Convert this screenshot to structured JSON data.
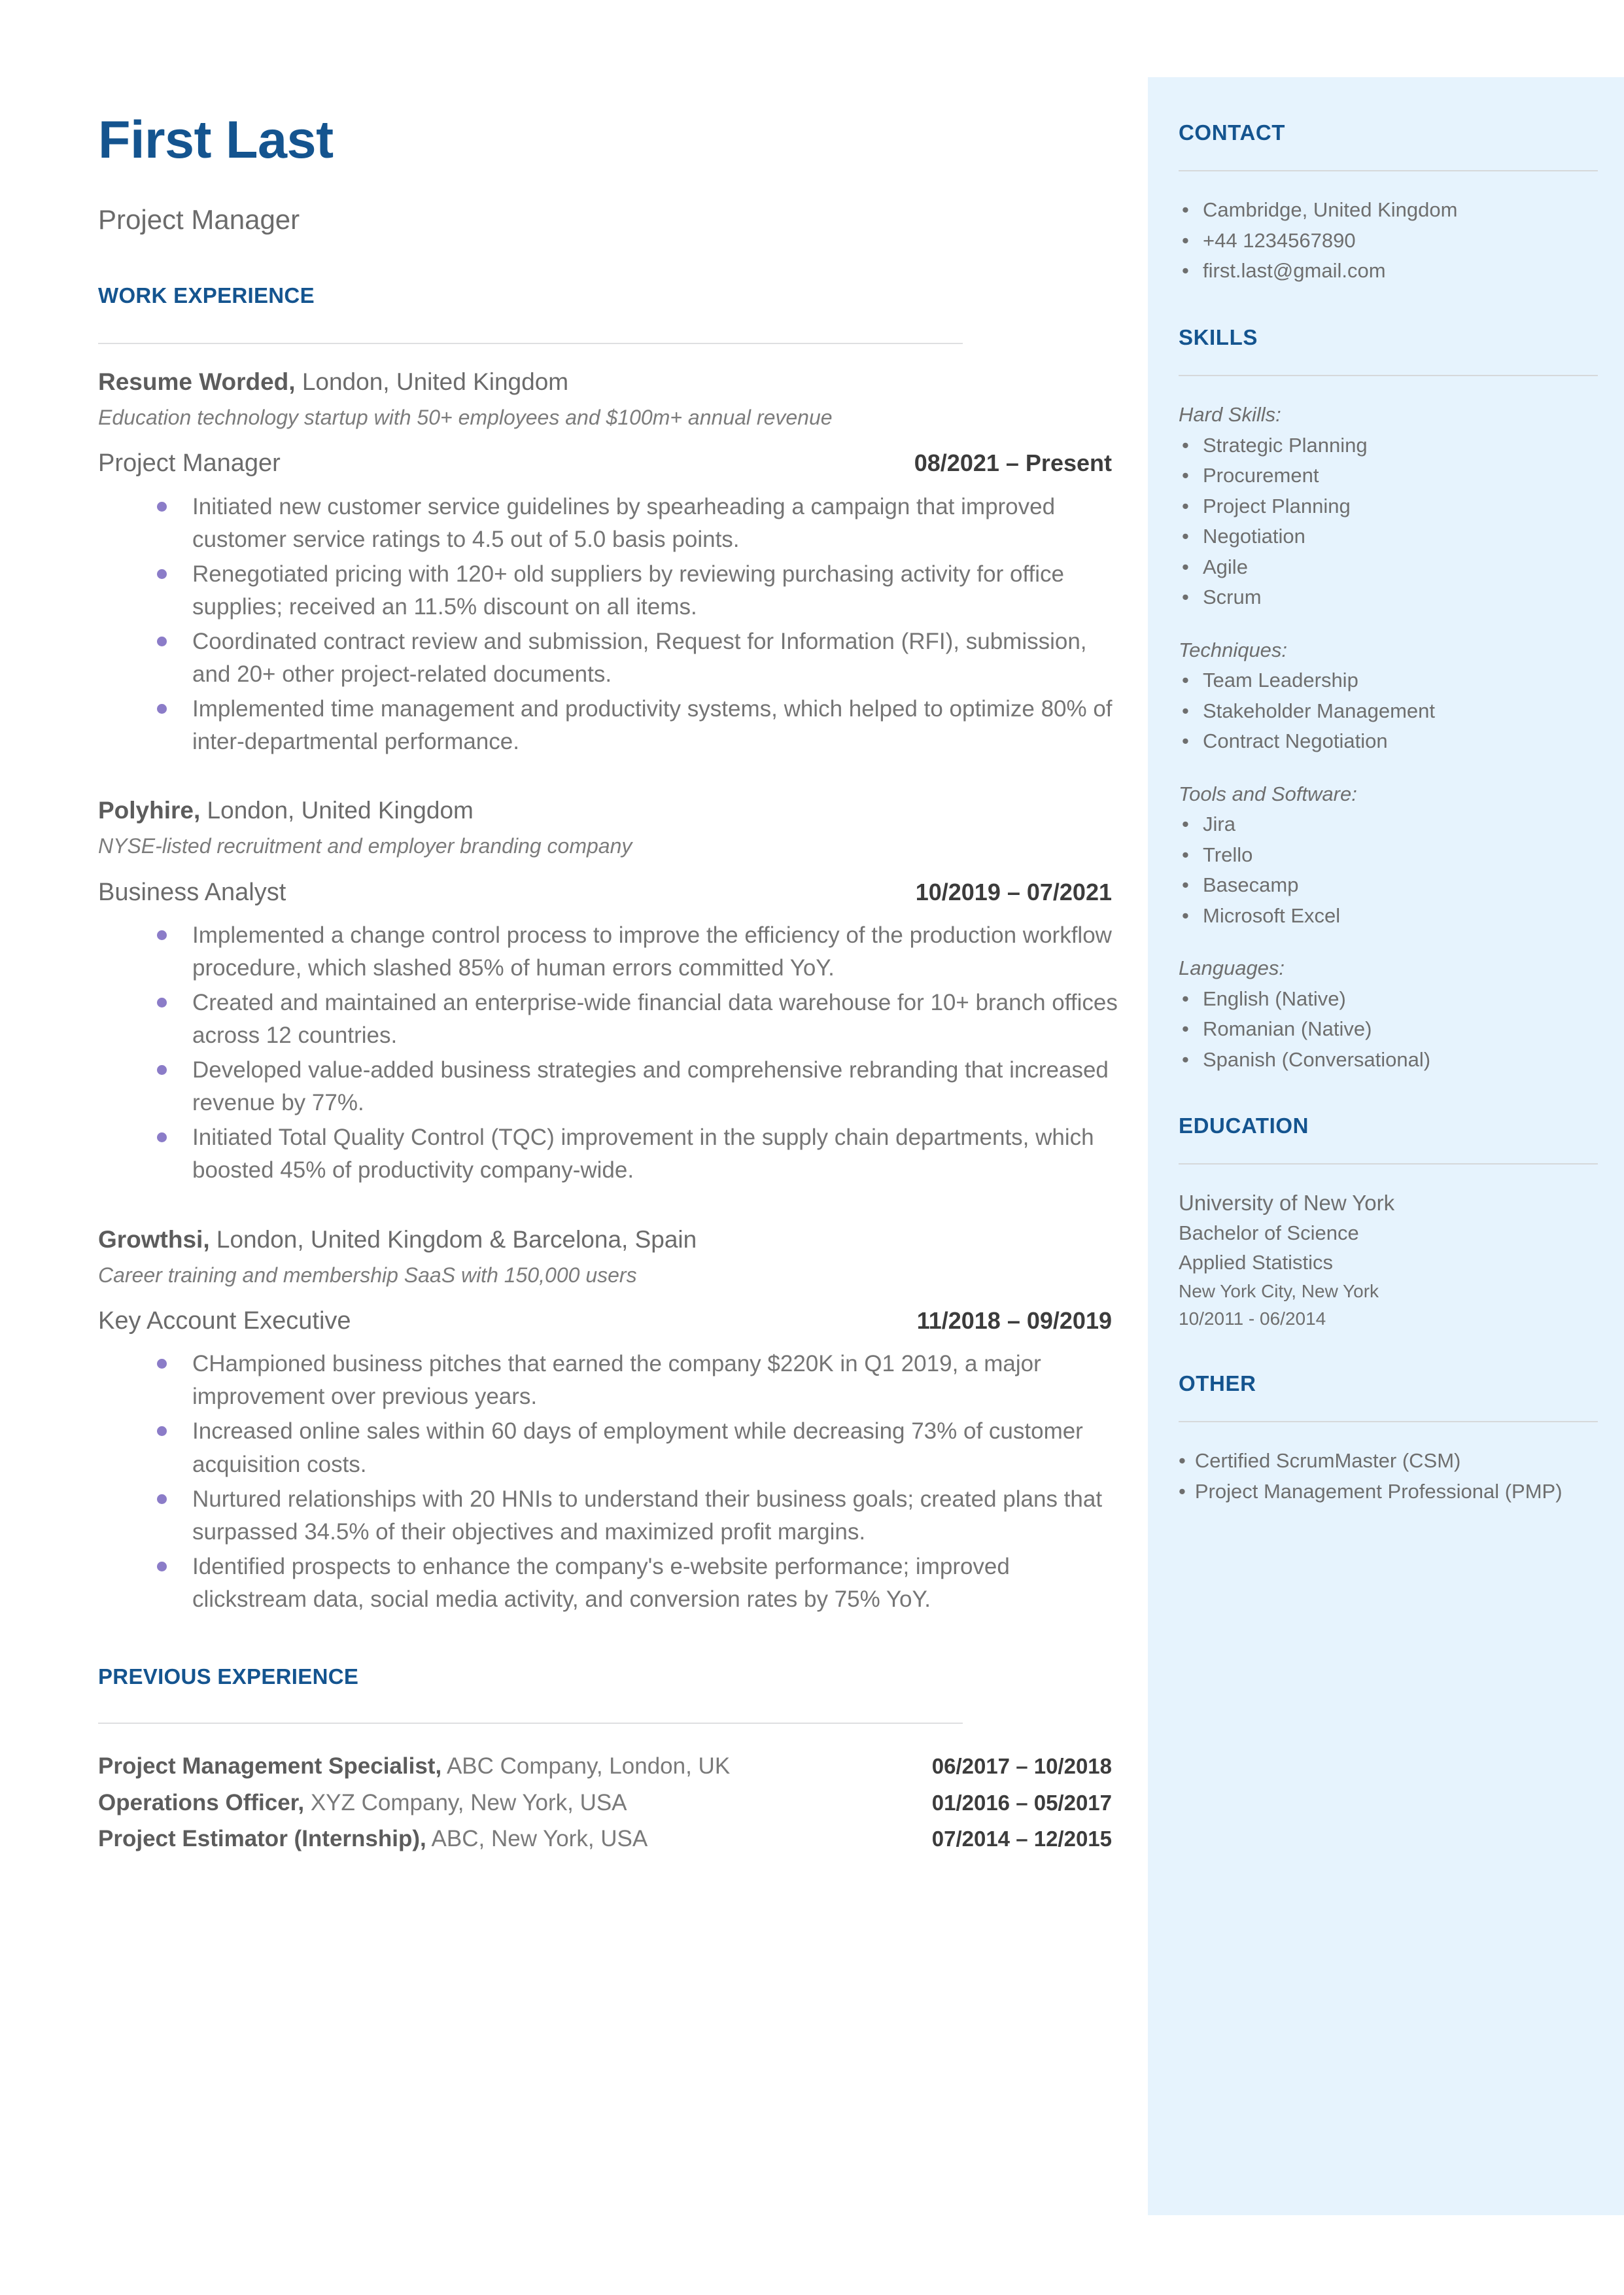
{
  "colors": {
    "accent_blue": "#14548f",
    "sidebar_bg": "#e6f3fd",
    "body_gray": "#6b6b6b",
    "bullet_purple": "#8b7cc8",
    "rule_gray": "#dedfe1"
  },
  "header": {
    "name": "First Last",
    "role": "Project Manager"
  },
  "sections": {
    "work_experience": "WORK EXPERIENCE",
    "previous_experience": "PREVIOUS EXPERIENCE",
    "contact": "CONTACT",
    "skills": "SKILLS",
    "education": "EDUCATION",
    "other": "OTHER"
  },
  "jobs": [
    {
      "company": "Resume Worded,",
      "location": " London, United Kingdom",
      "description": "Education technology startup with 50+ employees and $100m+ annual revenue",
      "title": "Project Manager",
      "date": "08/2021 – Present",
      "bullets": [
        "Initiated new customer service guidelines by spearheading a campaign that improved customer service ratings to 4.5 out of 5.0 basis points.",
        "Renegotiated pricing with 120+ old suppliers by reviewing purchasing activity for office supplies; received an 11.5% discount on all items.",
        "Coordinated contract review and submission, Request for Information (RFI), submission, and 20+ other project-related documents.",
        "Implemented time management and productivity systems, which helped to optimize 80% of inter-departmental performance."
      ]
    },
    {
      "company": "Polyhire,",
      "location": " London, United Kingdom",
      "description": "NYSE-listed recruitment and employer branding company",
      "title": "Business Analyst",
      "date": "10/2019 – 07/2021",
      "bullets": [
        "Implemented a change control process to improve the efficiency of the production workflow procedure, which slashed 85% of human errors committed YoY.",
        "Created and maintained an enterprise-wide financial data warehouse for 10+ branch offices across 12 countries.",
        "Developed value-added business strategies and comprehensive rebranding that increased revenue by 77%.",
        "Initiated Total Quality Control (TQC) improvement in the supply chain departments, which boosted 45% of productivity company-wide."
      ]
    },
    {
      "company": "Growthsi,",
      "location": " London, United Kingdom & Barcelona, Spain",
      "description": "Career training and membership SaaS with 150,000 users",
      "title": "Key Account Executive",
      "date": "11/2018 – 09/2019",
      "bullets": [
        "CHampioned business pitches that earned the company $220K in Q1 2019, a major improvement over previous years.",
        "Increased online sales within 60 days of employment while decreasing 73% of customer acquisition costs.",
        "Nurtured relationships with 20 HNIs to understand their business goals; created plans that surpassed 34.5% of their objectives and maximized profit margins.",
        "Identified prospects to enhance the company's e-website performance; improved clickstream data, social media activity, and conversion rates by 75% YoY."
      ]
    }
  ],
  "previous_experience": [
    {
      "title": "Project Management Specialist,",
      "detail": " ABC Company, London, UK",
      "date": "06/2017 – 10/2018"
    },
    {
      "title": "Operations Officer,",
      "detail": " XYZ Company, New York, USA",
      "date": "01/2016 – 05/2017"
    },
    {
      "title": "Project Estimator (Internship),",
      "detail": " ABC, New York, USA",
      "date": "07/2014 – 12/2015"
    }
  ],
  "contact": {
    "items": [
      "Cambridge, United Kingdom",
      "+44 1234567890",
      "first.last@gmail.com"
    ]
  },
  "skills": {
    "groups": [
      {
        "label": "Hard Skills:",
        "items": [
          "Strategic Planning",
          "Procurement",
          "Project Planning",
          "Negotiation",
          "Agile",
          "Scrum"
        ]
      },
      {
        "label": "Techniques:",
        "items": [
          "Team Leadership",
          "Stakeholder Management",
          "Contract Negotiation"
        ]
      },
      {
        "label": "Tools and Software:",
        "items": [
          "Jira",
          "Trello",
          "Basecamp",
          "Microsoft Excel"
        ]
      },
      {
        "label": "Languages:",
        "items": [
          "English (Native)",
          "Romanian (Native)",
          "Spanish (Conversational)"
        ]
      }
    ]
  },
  "education": {
    "school": "University of New York",
    "degree": "Bachelor of Science",
    "field": "Applied Statistics",
    "location": "New York City, New York",
    "dates": "10/2011 - 06/2014"
  },
  "other": {
    "items": [
      "Certified ScrumMaster (CSM)",
      "Project Management Professional (PMP)"
    ]
  },
  "icons": {
    "bullet_dot": "•"
  }
}
